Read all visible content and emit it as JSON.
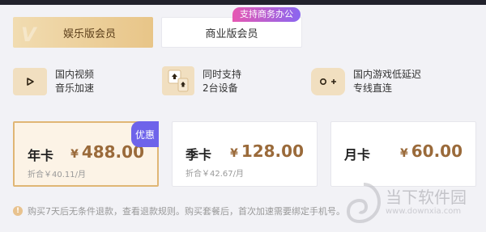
{
  "tabs": {
    "entertainment": "娱乐版会员",
    "business": "商业版会员",
    "business_badge": "支持商务办公"
  },
  "features": [
    {
      "line1": "国内视频",
      "line2": "音乐加速",
      "icon": "play-icon"
    },
    {
      "line1": "同时支持",
      "line2": "2台设备",
      "icon": "devices-icon"
    },
    {
      "line1": "国内游戏低延迟",
      "line2": "专线直连",
      "icon": "gamepad-icon"
    }
  ],
  "plans": [
    {
      "name": "年卡",
      "currency": "¥",
      "price": "488.00",
      "sub": "折合￥40.11/月",
      "badge": "优惠",
      "selected": true
    },
    {
      "name": "季卡",
      "currency": "¥",
      "price": "128.00",
      "sub": "折合￥42.67/月",
      "selected": false
    },
    {
      "name": "月卡",
      "currency": "¥",
      "price": "60.00",
      "sub": "",
      "selected": false
    }
  ],
  "notice": {
    "icon": "info-icon",
    "text": "购买7天后无条件退款，查看退款规则。购买套餐后，首次加速需要绑定手机号。"
  },
  "watermark": {
    "cn": "当下软件园",
    "url": "www.downxia.com"
  },
  "colors": {
    "accent_gold": "#e8c588",
    "price": "#9a6a3a",
    "badge_purple": "#6e63ea"
  }
}
